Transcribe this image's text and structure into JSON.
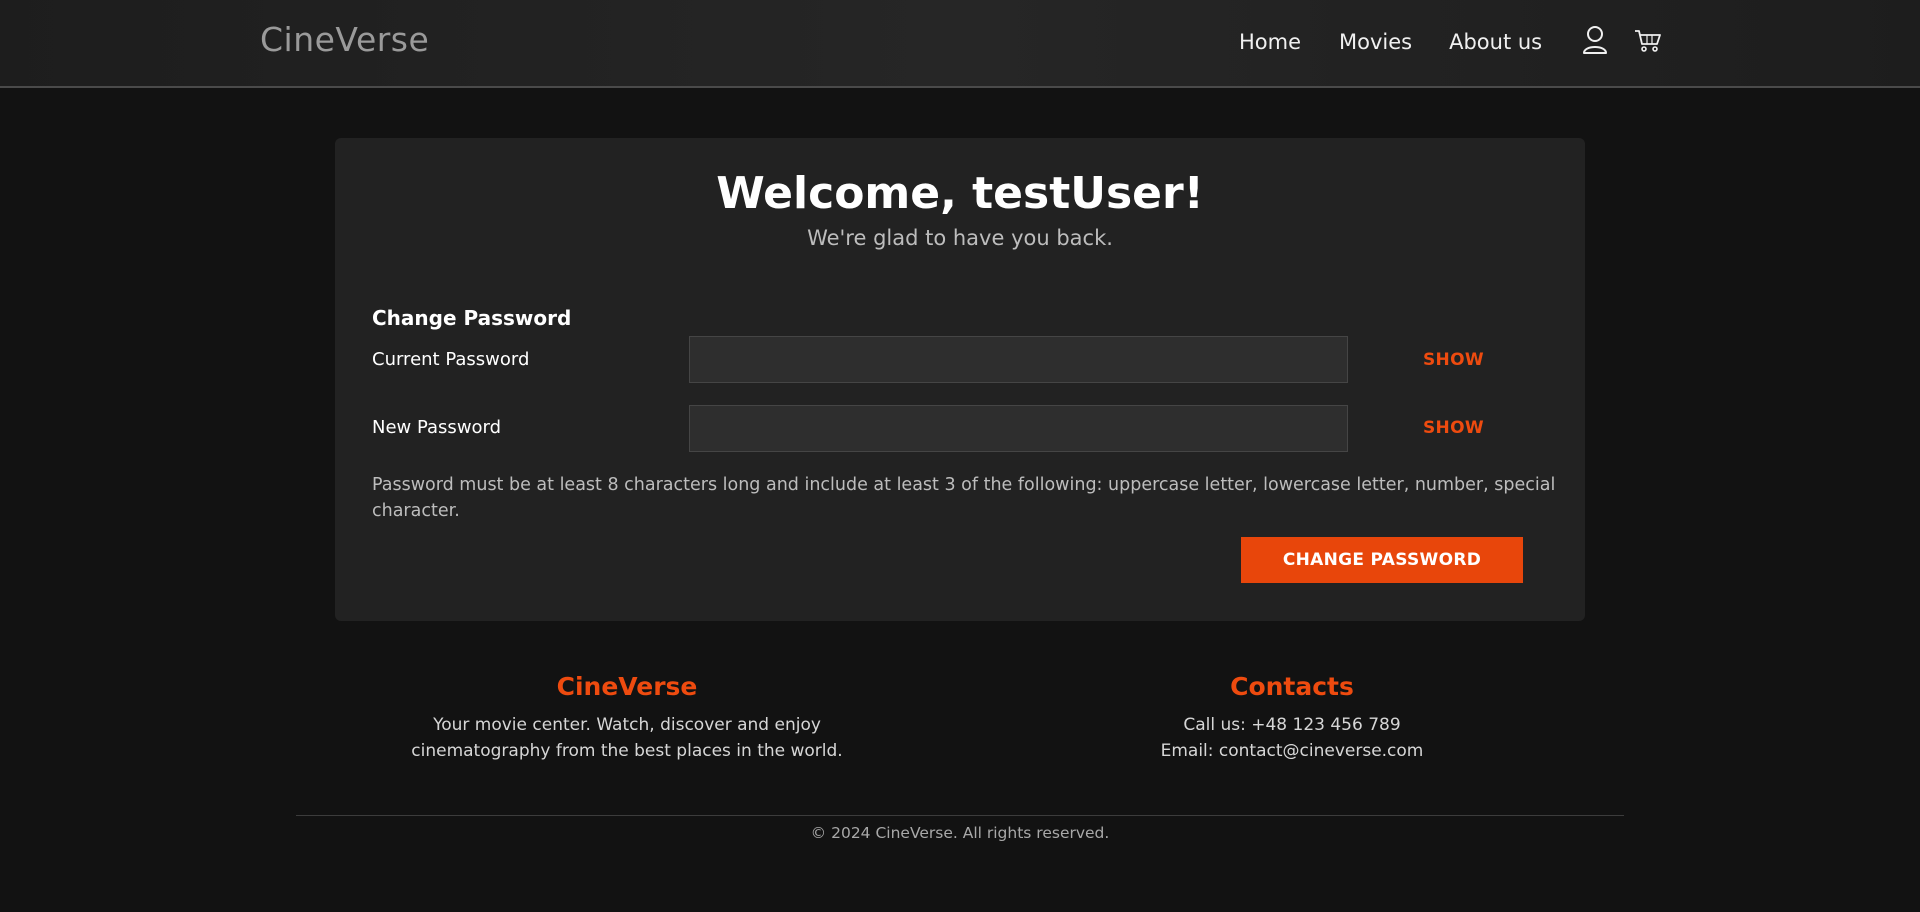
{
  "header": {
    "logo": "CineVerse",
    "nav": {
      "home": "Home",
      "movies": "Movies",
      "about": "About us"
    },
    "icons": [
      "user-icon",
      "cart-icon"
    ]
  },
  "card": {
    "title": "Welcome, testUser!",
    "subtitle": "We're glad to have you back.",
    "section_title": "Change Password",
    "current_label": "Current Password",
    "new_label": "New Password",
    "current_value": "",
    "new_value": "",
    "show_label": "SHOW",
    "hint": "Password must be at least 8 characters long and include at least 3 of the following: uppercase letter, lowercase letter, number, special character.",
    "submit_label": "CHANGE PASSWORD"
  },
  "footer": {
    "brand_title": "CineVerse",
    "brand_line1": "Your movie center. Watch, discover and enjoy",
    "brand_line2": "cinematography from the best places in the world.",
    "contacts_title": "Contacts",
    "phone": "Call us: +48 123 456 789",
    "email": "Email: contact@cineverse.com",
    "copyright": "© 2024 CineVerse. All rights reserved."
  },
  "colors": {
    "accent": "#e8460b",
    "background": "#121212",
    "card": "#222222",
    "header": "#222222"
  }
}
